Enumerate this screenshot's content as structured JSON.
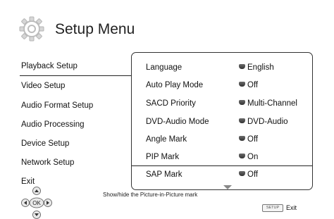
{
  "header": {
    "title": "Setup Menu",
    "icon": "gear-icon"
  },
  "menu": {
    "items": [
      {
        "label": "Playback Setup",
        "selected": true
      },
      {
        "label": "Video Setup",
        "selected": false
      },
      {
        "label": "Audio Format Setup",
        "selected": false
      },
      {
        "label": "Audio Processing",
        "selected": false
      },
      {
        "label": "Device Setup",
        "selected": false
      },
      {
        "label": "Network Setup",
        "selected": false
      },
      {
        "label": "Exit",
        "selected": false
      }
    ]
  },
  "panel": {
    "rows": [
      {
        "label": "Language",
        "value": "English"
      },
      {
        "label": "Auto Play Mode",
        "value": "Off"
      },
      {
        "label": "SACD Priority",
        "value": "Multi-Channel"
      },
      {
        "label": "DVD-Audio Mode",
        "value": "DVD-Audio"
      },
      {
        "label": "Angle Mark",
        "value": "Off"
      },
      {
        "label": "PIP Mark",
        "value": "On",
        "selected": true
      },
      {
        "label": "SAP Mark",
        "value": "Off"
      }
    ]
  },
  "footer": {
    "hint": "Show/hide the Picture-in-Picture mark",
    "setup_key": "SETUP",
    "exit_label": "Exit",
    "nav_center": "OK"
  }
}
